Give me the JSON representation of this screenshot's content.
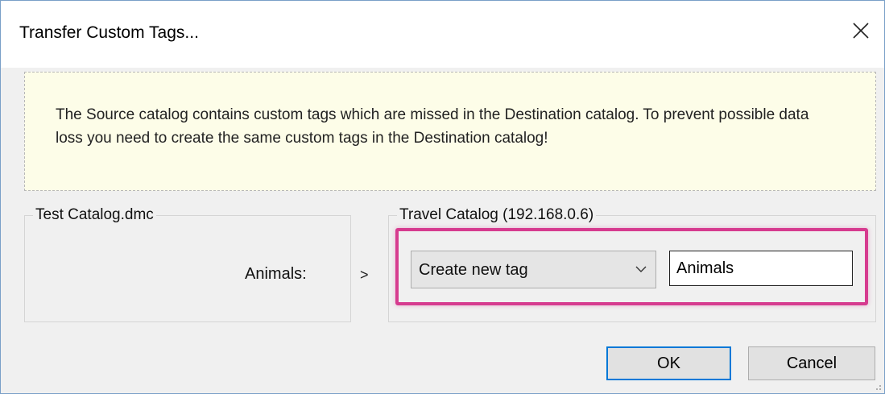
{
  "window": {
    "title": "Transfer Custom Tags...",
    "close_icon": "close-icon"
  },
  "info": {
    "message": "The Source catalog contains custom tags which are missed in the Destination catalog. To prevent possible data loss you need to create the same custom tags in the Destination catalog!",
    "background_color": "#fdfde8"
  },
  "source": {
    "group_label": "Test Catalog.dmc",
    "tag_label": "Animals:"
  },
  "arrow": ">",
  "destination": {
    "group_label": "Travel Catalog (192.168.0.6)",
    "action_select_value": "Create new tag",
    "tag_name_value": "Animals"
  },
  "buttons": {
    "ok_label": "OK",
    "cancel_label": "Cancel"
  },
  "colors": {
    "highlight": "#d63b8f",
    "focus_border": "#0078d7"
  }
}
